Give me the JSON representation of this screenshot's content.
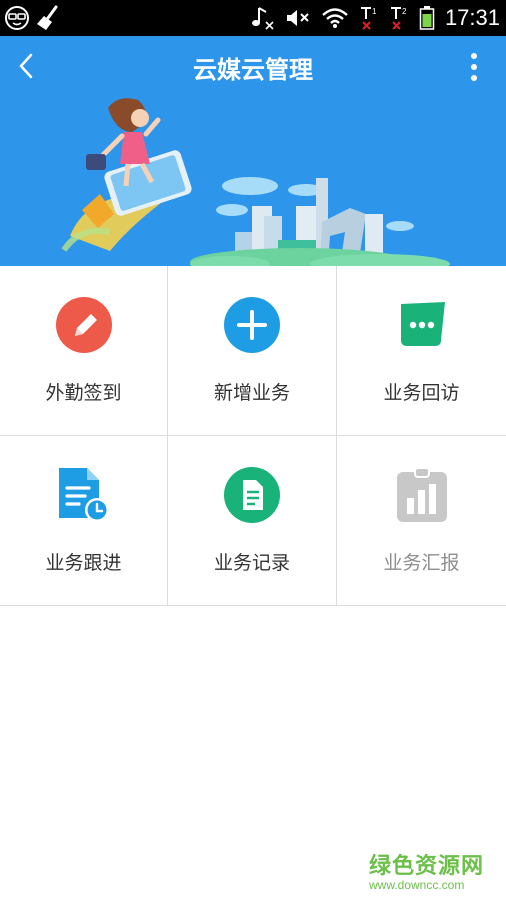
{
  "status_bar": {
    "time": "17:31",
    "sim1": "1",
    "sim2": "2"
  },
  "header": {
    "title": "云媒云管理"
  },
  "grid": {
    "items": [
      {
        "label": "外勤签到",
        "icon": "pencil-icon",
        "color": "#ee5a4a"
      },
      {
        "label": "新增业务",
        "icon": "plus-icon",
        "color": "#1e9de5"
      },
      {
        "label": "业务回访",
        "icon": "chat-bubble-icon",
        "color": "#19b37a"
      },
      {
        "label": "业务跟进",
        "icon": "document-clock-icon",
        "color": "#1e9de5"
      },
      {
        "label": "业务记录",
        "icon": "document-icon",
        "color": "#19b37a"
      },
      {
        "label": "业务汇报",
        "icon": "report-chart-icon",
        "color": "#c8c8c8"
      }
    ]
  },
  "watermark": {
    "main": "绿色资源网",
    "sub": "www.downcc.com"
  }
}
